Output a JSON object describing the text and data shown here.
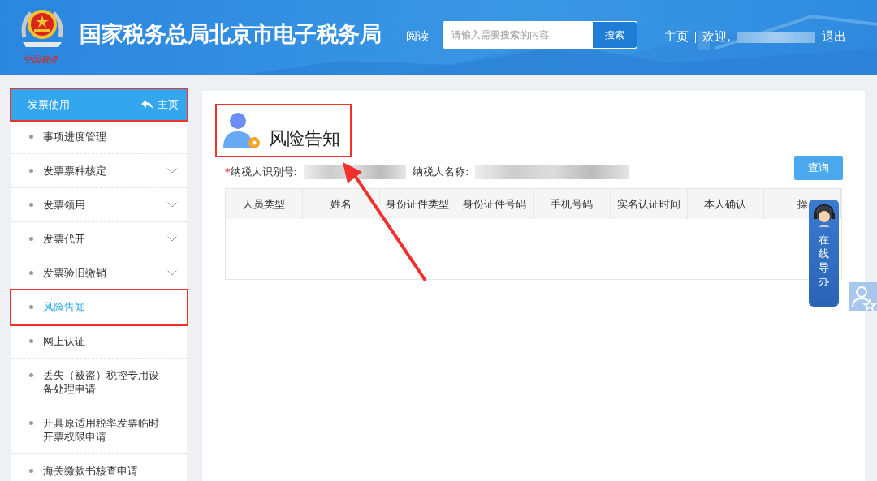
{
  "header": {
    "logo_caption": "中国税务",
    "title": "国家税务总局北京市电子税务局",
    "hidden_link": "阅读",
    "search": {
      "placeholder": "请输入需要搜索的内容",
      "button": "搜索"
    },
    "nav": [
      {
        "label": "主页"
      },
      {
        "label": "欢迎,"
      },
      {
        "label": "退出"
      }
    ]
  },
  "sidebar": {
    "title": "发票使用",
    "home": "主页",
    "annotated": true,
    "items": [
      {
        "label": "事项进度管理",
        "expandable": false,
        "selected": false,
        "annotated": false
      },
      {
        "label": "发票票种核定",
        "expandable": true,
        "selected": false,
        "annotated": false
      },
      {
        "label": "发票领用",
        "expandable": true,
        "selected": false,
        "annotated": false
      },
      {
        "label": "发票代开",
        "expandable": true,
        "selected": false,
        "annotated": false
      },
      {
        "label": "发票验旧缴销",
        "expandable": true,
        "selected": false,
        "annotated": false
      },
      {
        "label": "风险告知",
        "expandable": false,
        "selected": true,
        "annotated": true
      },
      {
        "label": "网上认证",
        "expandable": false,
        "selected": false,
        "annotated": false
      },
      {
        "label": "丢失（被盗）税控专用设备处理申请",
        "expandable": false,
        "selected": false,
        "annotated": false
      },
      {
        "label": "开具原适用税率发票临时开票权限申请",
        "expandable": false,
        "selected": false,
        "annotated": false
      },
      {
        "label": "海关缴款书核查申请",
        "expandable": false,
        "selected": false,
        "annotated": false
      }
    ]
  },
  "main": {
    "title": "风险告知",
    "title_annotated": true,
    "fields": [
      {
        "label": "纳税人识别号:",
        "required": true,
        "required_mark": "*"
      },
      {
        "label": "纳税人名称:",
        "required": false
      }
    ],
    "query_button": "查询",
    "table": {
      "columns": [
        "人员类型",
        "姓名",
        "身份证件类型",
        "身份证件号码",
        "手机号码",
        "实名认证时间",
        "本人确认",
        "操"
      ]
    }
  },
  "widget": {
    "label": "在线导办"
  }
}
